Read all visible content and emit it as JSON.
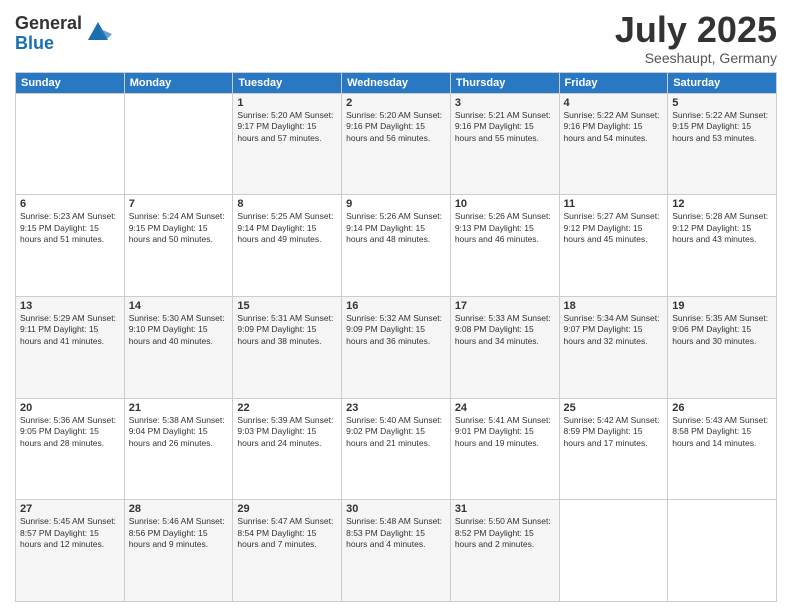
{
  "logo": {
    "general": "General",
    "blue": "Blue"
  },
  "header": {
    "month": "July 2025",
    "location": "Seeshaupt, Germany"
  },
  "weekdays": [
    "Sunday",
    "Monday",
    "Tuesday",
    "Wednesday",
    "Thursday",
    "Friday",
    "Saturday"
  ],
  "weeks": [
    [
      {
        "day": "",
        "info": ""
      },
      {
        "day": "",
        "info": ""
      },
      {
        "day": "1",
        "info": "Sunrise: 5:20 AM\nSunset: 9:17 PM\nDaylight: 15 hours and 57 minutes."
      },
      {
        "day": "2",
        "info": "Sunrise: 5:20 AM\nSunset: 9:16 PM\nDaylight: 15 hours and 56 minutes."
      },
      {
        "day": "3",
        "info": "Sunrise: 5:21 AM\nSunset: 9:16 PM\nDaylight: 15 hours and 55 minutes."
      },
      {
        "day": "4",
        "info": "Sunrise: 5:22 AM\nSunset: 9:16 PM\nDaylight: 15 hours and 54 minutes."
      },
      {
        "day": "5",
        "info": "Sunrise: 5:22 AM\nSunset: 9:15 PM\nDaylight: 15 hours and 53 minutes."
      }
    ],
    [
      {
        "day": "6",
        "info": "Sunrise: 5:23 AM\nSunset: 9:15 PM\nDaylight: 15 hours and 51 minutes."
      },
      {
        "day": "7",
        "info": "Sunrise: 5:24 AM\nSunset: 9:15 PM\nDaylight: 15 hours and 50 minutes."
      },
      {
        "day": "8",
        "info": "Sunrise: 5:25 AM\nSunset: 9:14 PM\nDaylight: 15 hours and 49 minutes."
      },
      {
        "day": "9",
        "info": "Sunrise: 5:26 AM\nSunset: 9:14 PM\nDaylight: 15 hours and 48 minutes."
      },
      {
        "day": "10",
        "info": "Sunrise: 5:26 AM\nSunset: 9:13 PM\nDaylight: 15 hours and 46 minutes."
      },
      {
        "day": "11",
        "info": "Sunrise: 5:27 AM\nSunset: 9:12 PM\nDaylight: 15 hours and 45 minutes."
      },
      {
        "day": "12",
        "info": "Sunrise: 5:28 AM\nSunset: 9:12 PM\nDaylight: 15 hours and 43 minutes."
      }
    ],
    [
      {
        "day": "13",
        "info": "Sunrise: 5:29 AM\nSunset: 9:11 PM\nDaylight: 15 hours and 41 minutes."
      },
      {
        "day": "14",
        "info": "Sunrise: 5:30 AM\nSunset: 9:10 PM\nDaylight: 15 hours and 40 minutes."
      },
      {
        "day": "15",
        "info": "Sunrise: 5:31 AM\nSunset: 9:09 PM\nDaylight: 15 hours and 38 minutes."
      },
      {
        "day": "16",
        "info": "Sunrise: 5:32 AM\nSunset: 9:09 PM\nDaylight: 15 hours and 36 minutes."
      },
      {
        "day": "17",
        "info": "Sunrise: 5:33 AM\nSunset: 9:08 PM\nDaylight: 15 hours and 34 minutes."
      },
      {
        "day": "18",
        "info": "Sunrise: 5:34 AM\nSunset: 9:07 PM\nDaylight: 15 hours and 32 minutes."
      },
      {
        "day": "19",
        "info": "Sunrise: 5:35 AM\nSunset: 9:06 PM\nDaylight: 15 hours and 30 minutes."
      }
    ],
    [
      {
        "day": "20",
        "info": "Sunrise: 5:36 AM\nSunset: 9:05 PM\nDaylight: 15 hours and 28 minutes."
      },
      {
        "day": "21",
        "info": "Sunrise: 5:38 AM\nSunset: 9:04 PM\nDaylight: 15 hours and 26 minutes."
      },
      {
        "day": "22",
        "info": "Sunrise: 5:39 AM\nSunset: 9:03 PM\nDaylight: 15 hours and 24 minutes."
      },
      {
        "day": "23",
        "info": "Sunrise: 5:40 AM\nSunset: 9:02 PM\nDaylight: 15 hours and 21 minutes."
      },
      {
        "day": "24",
        "info": "Sunrise: 5:41 AM\nSunset: 9:01 PM\nDaylight: 15 hours and 19 minutes."
      },
      {
        "day": "25",
        "info": "Sunrise: 5:42 AM\nSunset: 8:59 PM\nDaylight: 15 hours and 17 minutes."
      },
      {
        "day": "26",
        "info": "Sunrise: 5:43 AM\nSunset: 8:58 PM\nDaylight: 15 hours and 14 minutes."
      }
    ],
    [
      {
        "day": "27",
        "info": "Sunrise: 5:45 AM\nSunset: 8:57 PM\nDaylight: 15 hours and 12 minutes."
      },
      {
        "day": "28",
        "info": "Sunrise: 5:46 AM\nSunset: 8:56 PM\nDaylight: 15 hours and 9 minutes."
      },
      {
        "day": "29",
        "info": "Sunrise: 5:47 AM\nSunset: 8:54 PM\nDaylight: 15 hours and 7 minutes."
      },
      {
        "day": "30",
        "info": "Sunrise: 5:48 AM\nSunset: 8:53 PM\nDaylight: 15 hours and 4 minutes."
      },
      {
        "day": "31",
        "info": "Sunrise: 5:50 AM\nSunset: 8:52 PM\nDaylight: 15 hours and 2 minutes."
      },
      {
        "day": "",
        "info": ""
      },
      {
        "day": "",
        "info": ""
      }
    ]
  ]
}
